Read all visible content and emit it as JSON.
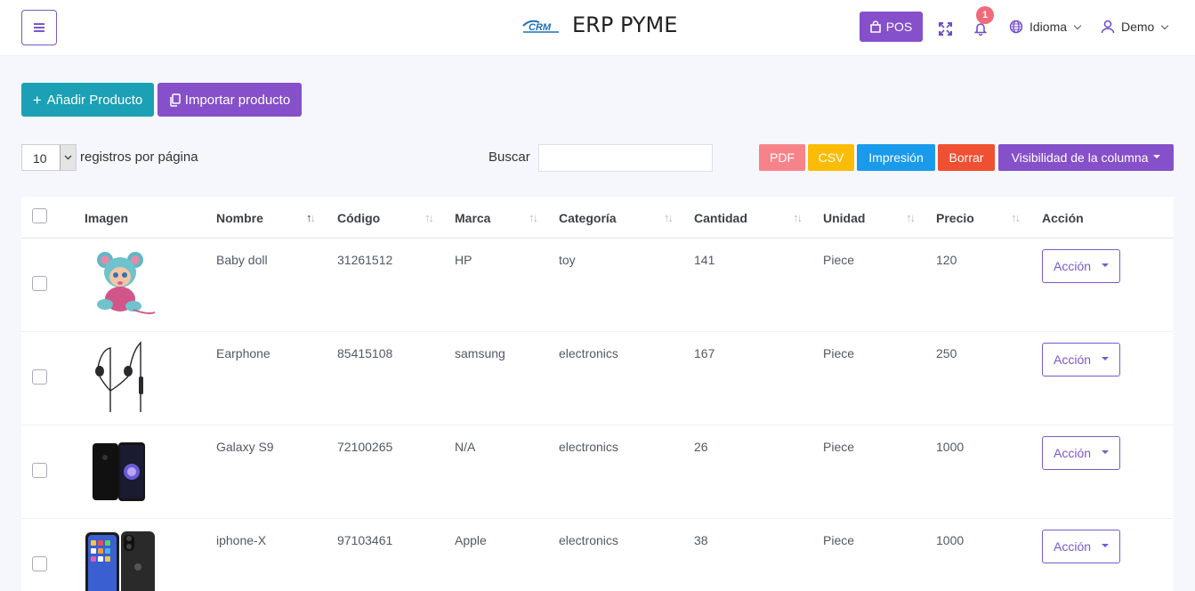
{
  "header": {
    "app_title": "ERP PYME",
    "logo_text": "CRM",
    "pos_label": "POS",
    "notification_count": "1",
    "language_label": "Idioma",
    "user_label": "Demo"
  },
  "actions": {
    "add_label": "Añadir Producto",
    "import_label": "Importar producto"
  },
  "table_controls": {
    "page_size": "10",
    "per_page_label": "registros por página",
    "search_label": "Buscar",
    "search_value": "",
    "export_buttons": [
      {
        "label": "PDF",
        "color": "#f7838a"
      },
      {
        "label": "CSV",
        "color": "#fbbc05"
      },
      {
        "label": "Impresión",
        "color": "#1a9aeb"
      },
      {
        "label": "Borrar",
        "color": "#ef5032"
      },
      {
        "label": "Visibilidad de la columna",
        "color": "#8550c9"
      }
    ]
  },
  "table": {
    "columns": [
      "Imagen",
      "Nombre",
      "Código",
      "Marca",
      "Categoría",
      "Cantidad",
      "Unidad",
      "Precio",
      "Acción"
    ],
    "action_label": "Acción",
    "rows": [
      {
        "image_icon": "baby-doll-image",
        "nombre": "Baby doll",
        "codigo": "31261512",
        "marca": "HP",
        "categoria": "toy",
        "cantidad": "141",
        "unidad": "Piece",
        "precio": "120"
      },
      {
        "image_icon": "earphone-image",
        "nombre": "Earphone",
        "codigo": "85415108",
        "marca": "samsung",
        "categoria": "electronics",
        "cantidad": "167",
        "unidad": "Piece",
        "precio": "250"
      },
      {
        "image_icon": "galaxy-s9-image",
        "nombre": "Galaxy S9",
        "codigo": "72100265",
        "marca": "N/A",
        "categoria": "electronics",
        "cantidad": "26",
        "unidad": "Piece",
        "precio": "1000"
      },
      {
        "image_icon": "iphone-x-image",
        "nombre": "iphone-X",
        "codigo": "97103461",
        "marca": "Apple",
        "categoria": "electronics",
        "cantidad": "38",
        "unidad": "Piece",
        "precio": "1000"
      }
    ]
  },
  "colors": {
    "accent_purple": "#8550c9",
    "accent_teal": "#1ba0b5",
    "badge_red": "#f06a7a"
  }
}
